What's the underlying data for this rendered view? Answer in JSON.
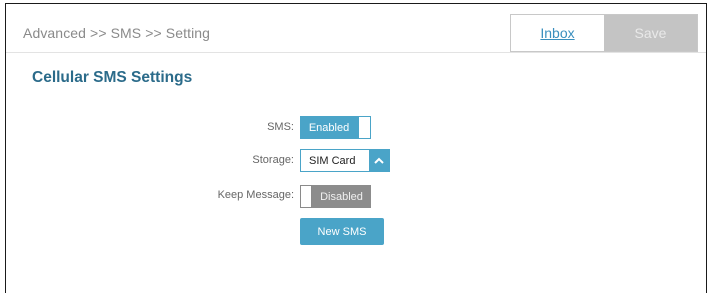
{
  "breadcrumb": "Advanced >> SMS >> Setting",
  "header": {
    "inbox_label": "Inbox",
    "save_label": "Save"
  },
  "section_title": "Cellular SMS Settings",
  "form": {
    "sms": {
      "label": "SMS:",
      "state": "Enabled"
    },
    "storage": {
      "label": "Storage:",
      "value": "SIM Card"
    },
    "keep_message": {
      "label": "Keep Message:",
      "state": "Disabled"
    },
    "new_sms_label": "New SMS"
  },
  "colors": {
    "accent": "#4aa4c8",
    "title": "#2b6b8a",
    "disabled": "#8c8c8c",
    "save_disabled_bg": "#c4c4c4"
  },
  "icons": {
    "storage_arrow": "chevron-up-icon"
  }
}
